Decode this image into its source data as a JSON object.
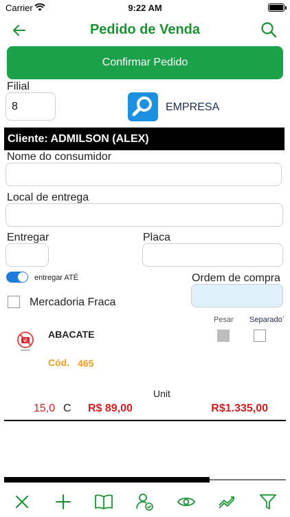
{
  "status_bar": {
    "carrier": "Carrier",
    "time": "9:22 AM"
  },
  "nav": {
    "title": "Pedido de Venda",
    "back_icon": "arrow-left-icon",
    "search_icon": "search-icon",
    "accent_color": "#17942f"
  },
  "confirm_button": {
    "label": "Confirmar Pedido",
    "color": "#1aa14a"
  },
  "filial": {
    "label": "Filial",
    "value": "8"
  },
  "empresa": {
    "label": "EMPRESA",
    "icon": "search-icon"
  },
  "cliente": {
    "text": "Cliente: ADMILSON (ALEX)"
  },
  "nome_consumidor": {
    "label": "Nome do consumidor",
    "value": ""
  },
  "local_entrega": {
    "label": "Local de entrega",
    "value": ""
  },
  "entregar": {
    "label": "Entregar",
    "value": ""
  },
  "placa": {
    "label": "Placa",
    "value": ""
  },
  "entregar_ate": {
    "label": "entregar ATÉ",
    "on": true
  },
  "ordem_compra": {
    "label": "Ordem de compra",
    "value": ""
  },
  "mercadoria_fraca": {
    "label": "Mercadoria Fraca",
    "checked": false
  },
  "item": {
    "name": "ABACATE",
    "cod_label": "Cód.",
    "cod_value": "465",
    "pesar_label": "Pesar",
    "separado_label": "Separado´",
    "unit_header": "Unit",
    "quantity": "15,0",
    "unit": "C",
    "unit_price": "R$ 89,00",
    "total": "R$1.335,00",
    "thumb_icon": "no-photo-icon"
  },
  "scroll_progress": 0.73,
  "toolbar": {
    "items": [
      "close-icon",
      "plus-icon",
      "book-icon",
      "user-check-icon",
      "eye-icon",
      "trend-icon",
      "filter-icon"
    ]
  }
}
